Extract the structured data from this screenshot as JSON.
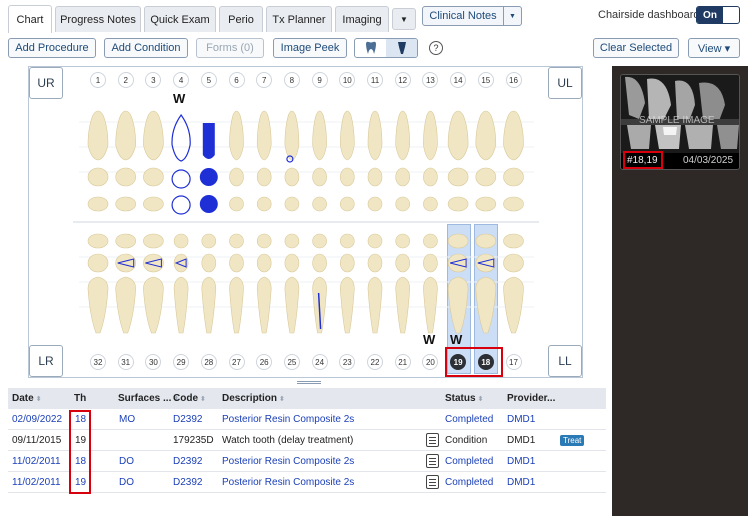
{
  "tabs": [
    {
      "label": "Chart",
      "active": true
    },
    {
      "label": "Progress Notes"
    },
    {
      "label": "Quick Exam"
    },
    {
      "label": "Perio"
    },
    {
      "label": "Tx Planner"
    },
    {
      "label": "Imaging"
    }
  ],
  "header": {
    "clinical_notes": "Clinical Notes",
    "chairside_label": "Chairside dashboard",
    "toggle_state": "On"
  },
  "toolbar": {
    "add_procedure": "Add Procedure",
    "add_condition": "Add Condition",
    "forms": "Forms (0)",
    "image_peek": "Image Peek",
    "clear_selected": "Clear Selected",
    "view": "View ▾",
    "help": "?"
  },
  "chart": {
    "quadrants": {
      "ur": "UR",
      "ul": "UL",
      "lr": "LR",
      "ll": "LL"
    },
    "upper_numbers": [
      "1",
      "2",
      "3",
      "4",
      "5",
      "6",
      "7",
      "8",
      "9",
      "10",
      "11",
      "12",
      "13",
      "14",
      "15",
      "16"
    ],
    "lower_numbers": [
      "32",
      "31",
      "30",
      "29",
      "28",
      "27",
      "26",
      "25",
      "24",
      "23",
      "22",
      "21",
      "20",
      "19",
      "18",
      "17"
    ],
    "selected_teeth": [
      "19",
      "18"
    ],
    "watch_marks": [
      "W",
      "W",
      "W"
    ],
    "colors": {
      "selected": "#bcd3f2",
      "restoration": "#1f2fd6",
      "tooth": "#f1e6c4",
      "highlight_border": "#d8000c"
    }
  },
  "image_panel": {
    "tooth_label": "#18,19",
    "date": "04/03/2025",
    "watermark": "SAMPLE IMAGE"
  },
  "table": {
    "headers": [
      "Date",
      "Th",
      "Surfaces ...",
      "Code",
      "Description",
      "Status",
      "Provider..."
    ],
    "rows": [
      {
        "date": "02/09/2022",
        "th": "18",
        "surfaces": "MO",
        "code": "D2392",
        "description": "Posterior Resin Composite 2s",
        "status": "Completed",
        "provider": "DMD1",
        "note": false,
        "treat": ""
      },
      {
        "date": "09/11/2015",
        "th": "19",
        "surfaces": "",
        "code": "179235D",
        "description": "Watch tooth (delay treatment)",
        "status": "Condition",
        "provider": "DMD1",
        "note": true,
        "treat": "Treat"
      },
      {
        "date": "11/02/2011",
        "th": "18",
        "surfaces": "DO",
        "code": "D2392",
        "description": "Posterior Resin Composite 2s",
        "status": "Completed",
        "provider": "DMD1",
        "note": true,
        "treat": ""
      },
      {
        "date": "11/02/2011",
        "th": "19",
        "surfaces": "DO",
        "code": "D2392",
        "description": "Posterior Resin Composite 2s",
        "status": "Completed",
        "provider": "DMD1",
        "note": true,
        "treat": ""
      }
    ]
  }
}
